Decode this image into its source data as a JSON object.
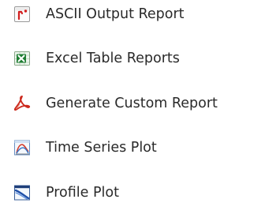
{
  "menu": {
    "items": [
      {
        "label": "ASCII Output Report",
        "icon": "ascii-report-icon"
      },
      {
        "label": "Excel Table Reports",
        "icon": "excel-icon"
      },
      {
        "label": "Generate Custom Report",
        "icon": "pdf-icon"
      },
      {
        "label": "Time Series Plot",
        "icon": "time-series-plot-icon"
      },
      {
        "label": "Profile Plot",
        "icon": "profile-plot-icon"
      }
    ]
  },
  "colors": {
    "text": "#2a2a2a",
    "ascii_red": "#d21f1f",
    "excel_green": "#1e7d32",
    "pdf_red": "#cc2a1e",
    "plot_blue": "#3a78c9"
  }
}
